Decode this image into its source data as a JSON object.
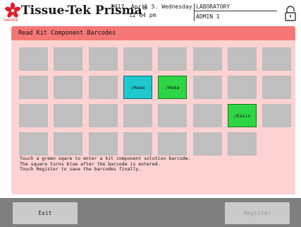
{
  "header": {
    "brand": "Tissue-Tek Prisma",
    "brand_mark": "®",
    "maker": "SAKURA",
    "date_line": "2017. April 5. Wednesday",
    "time_line": "12 04 pm",
    "location": "LABORATORY",
    "user": "ADMIN 1"
  },
  "panel": {
    "title": "Read Kit Component Barcodes",
    "instructions": [
      "Touch a green sqare to enter a kit component solution barcode.",
      "The square turns blue after the barcode is entered.",
      "Touch Register to save the barcodes finally."
    ]
  },
  "grid": {
    "rows": [
      [
        {
          "state": "empty",
          "label": ""
        },
        {
          "state": "empty",
          "label": ""
        },
        {
          "state": "empty",
          "label": ""
        },
        {
          "state": "empty",
          "label": ""
        },
        {
          "state": "empty",
          "label": ""
        },
        {
          "state": "empty",
          "label": ""
        },
        {
          "state": "empty",
          "label": ""
        },
        {
          "state": "empty",
          "label": ""
        }
      ],
      [
        {
          "state": "empty",
          "label": ""
        },
        {
          "state": "empty",
          "label": ""
        },
        {
          "state": "empty",
          "label": ""
        },
        {
          "state": "entered",
          "label": "/Hema"
        },
        {
          "state": "pending",
          "label": "/Hema"
        },
        {
          "state": "empty",
          "label": ""
        },
        {
          "state": "empty",
          "label": ""
        },
        {
          "state": "empty",
          "label": ""
        }
      ],
      [
        {
          "state": "empty",
          "label": ""
        },
        {
          "state": "empty",
          "label": ""
        },
        {
          "state": "empty",
          "label": ""
        },
        {
          "state": "empty",
          "label": ""
        },
        {
          "state": "empty",
          "label": ""
        },
        {
          "state": "empty",
          "label": ""
        },
        {
          "state": "pending",
          "label": "/Eosin"
        },
        {
          "state": "empty",
          "label": ""
        }
      ],
      [
        {
          "state": "empty",
          "label": ""
        },
        {
          "state": "empty",
          "label": ""
        },
        {
          "state": "empty",
          "label": ""
        },
        {
          "state": "empty",
          "label": ""
        },
        {
          "state": "empty",
          "label": ""
        },
        {
          "state": "empty",
          "label": ""
        },
        {
          "state": "empty",
          "label": ""
        }
      ]
    ]
  },
  "footer": {
    "exit_label": "Exit",
    "register_label": "Register"
  },
  "colors": {
    "panel_bg": "#fdd2d2",
    "panel_header": "#f57676",
    "entered": "#1ec8cf",
    "pending": "#2ed645",
    "empty": "#bfbfbf"
  },
  "icons": [
    "sakura-flower-icon",
    "lock-icon"
  ]
}
